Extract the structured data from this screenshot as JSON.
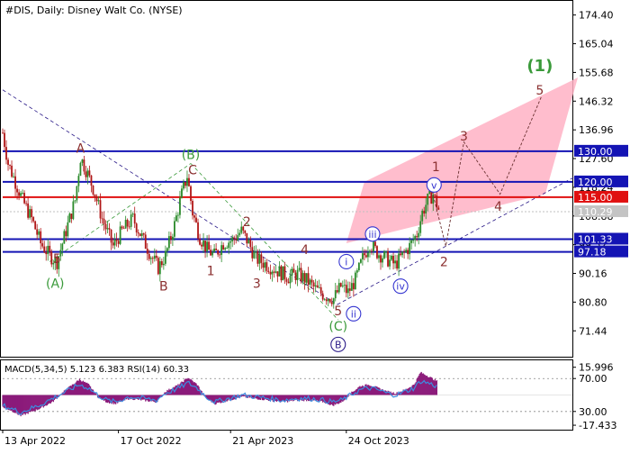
{
  "chart_data": [
    {
      "type": "candlestick",
      "title": "#DIS, Daily:  Disney Walt Co. (NYSE)",
      "ylim": [
        63.0,
        179.0
      ],
      "y_ticks": [
        71.44,
        80.8,
        90.16,
        99.52,
        108.88,
        118.24,
        127.6,
        136.96,
        146.32,
        155.68,
        165.04,
        174.4
      ],
      "y_tick_labels": [
        "71.44",
        "80.80",
        "90.16",
        "99.52",
        "108.88",
        "118.24",
        "127.60",
        "136.96",
        "146.32",
        "155.68",
        "165.04",
        "174.40"
      ],
      "x_ticks": [
        {
          "label": "13 Apr 2022",
          "index": 0
        },
        {
          "label": "17 Oct 2022",
          "index": 128
        },
        {
          "label": "21 Apr 2023",
          "index": 252
        },
        {
          "label": "24 Oct 2023",
          "index": 380
        }
      ],
      "x_range": [
        0,
        630
      ],
      "last_price": 110.29,
      "price_points": [
        [
          0,
          136
        ],
        [
          6,
          126
        ],
        [
          14,
          120
        ],
        [
          22,
          114
        ],
        [
          32,
          108
        ],
        [
          42,
          100
        ],
        [
          52,
          96
        ],
        [
          60,
          94
        ],
        [
          70,
          104
        ],
        [
          80,
          114
        ],
        [
          86,
          128
        ],
        [
          92,
          124
        ],
        [
          100,
          118
        ],
        [
          110,
          108
        ],
        [
          122,
          99
        ],
        [
          132,
          104
        ],
        [
          144,
          108
        ],
        [
          154,
          102
        ],
        [
          164,
          96
        ],
        [
          172,
          92
        ],
        [
          180,
          96
        ],
        [
          190,
          106
        ],
        [
          198,
          116
        ],
        [
          204,
          122
        ],
        [
          210,
          110
        ],
        [
          218,
          102
        ],
        [
          226,
          98
        ],
        [
          234,
          96
        ],
        [
          244,
          100
        ],
        [
          254,
          101
        ],
        [
          264,
          104
        ],
        [
          272,
          100
        ],
        [
          280,
          95
        ],
        [
          292,
          93
        ],
        [
          304,
          91
        ],
        [
          316,
          89
        ],
        [
          326,
          90
        ],
        [
          336,
          88
        ],
        [
          346,
          85
        ],
        [
          356,
          83
        ],
        [
          366,
          82
        ],
        [
          374,
          86
        ],
        [
          382,
          84
        ],
        [
          390,
          88
        ],
        [
          398,
          95
        ],
        [
          406,
          100
        ],
        [
          414,
          97
        ],
        [
          424,
          95
        ],
        [
          434,
          93
        ],
        [
          442,
          96
        ],
        [
          450,
          99
        ],
        [
          458,
          103
        ],
        [
          464,
          110
        ],
        [
          470,
          114
        ],
        [
          476,
          116
        ],
        [
          482,
          111
        ]
      ],
      "horizontal_levels": [
        {
          "value": 130.0,
          "label": "130.00",
          "color": "#1414b4",
          "label_bg": "#1414b4"
        },
        {
          "value": 120.0,
          "label": "120.00",
          "color": "#1414b4",
          "label_bg": "#1414b4"
        },
        {
          "value": 115.0,
          "label": "115.00",
          "color": "#e01010",
          "label_bg": "#e01010"
        },
        {
          "value": 101.33,
          "label": "101.33",
          "color": "#1414b4",
          "label_bg": "#1414b4"
        },
        {
          "value": 97.18,
          "label": "97.18",
          "color": "#1414b4",
          "label_bg": "#1414b4"
        }
      ],
      "last_price_label": "110.29",
      "wave_labels": [
        {
          "text": "A",
          "index": 86,
          "value": 131,
          "style": "brown"
        },
        {
          "text": "5",
          "index": 60,
          "value": 95,
          "style": "brown"
        },
        {
          "text": "(A)",
          "index": 58,
          "value": 87,
          "style": "green"
        },
        {
          "text": "B",
          "index": 178,
          "value": 86,
          "style": "brown"
        },
        {
          "text": "(B)",
          "index": 208,
          "value": 129,
          "style": "green"
        },
        {
          "text": "C",
          "index": 210,
          "value": 124,
          "style": "brown"
        },
        {
          "text": "1",
          "index": 230,
          "value": 91,
          "style": "brown"
        },
        {
          "text": "2",
          "index": 270,
          "value": 107,
          "style": "brown"
        },
        {
          "text": "3",
          "index": 281,
          "value": 87,
          "style": "brown"
        },
        {
          "text": "4",
          "index": 334,
          "value": 98,
          "style": "brown"
        },
        {
          "text": "5",
          "index": 371,
          "value": 78,
          "style": "brown"
        },
        {
          "text": "(C)",
          "index": 371,
          "value": 73,
          "style": "green"
        },
        {
          "text": "B",
          "index": 371,
          "value": 67,
          "style": "circle-navy"
        },
        {
          "text": "i",
          "index": 380,
          "value": 94,
          "style": "circle-blue"
        },
        {
          "text": "ii",
          "index": 388,
          "value": 77,
          "style": "circle-blue"
        },
        {
          "text": "iii",
          "index": 409,
          "value": 103,
          "style": "circle-blue"
        },
        {
          "text": "iv",
          "index": 440,
          "value": 86,
          "style": "circle-blue"
        },
        {
          "text": "v",
          "index": 477,
          "value": 119,
          "style": "circle-blue"
        },
        {
          "text": "1",
          "index": 479,
          "value": 125,
          "style": "brown"
        },
        {
          "text": "2",
          "index": 488,
          "value": 94,
          "style": "brown"
        },
        {
          "text": "3",
          "index": 510,
          "value": 135,
          "style": "brown"
        },
        {
          "text": "4",
          "index": 548,
          "value": 112,
          "style": "brown"
        },
        {
          "text": "5",
          "index": 594,
          "value": 150,
          "style": "brown"
        },
        {
          "text": "(1)",
          "index": 594,
          "value": 158,
          "style": "green-big"
        }
      ],
      "channel_polygon": [
        [
          400,
          120
        ],
        [
          636,
          154
        ],
        [
          600,
          116
        ],
        [
          380,
          100
        ]
      ],
      "forecast_path": [
        [
          475,
          117
        ],
        [
          490,
          99
        ],
        [
          510,
          133
        ],
        [
          550,
          116
        ],
        [
          596,
          148
        ]
      ],
      "trendlines": [
        {
          "points": [
            [
              0,
              150
            ],
            [
              370,
              80
            ]
          ],
          "style": "navy-dash"
        },
        {
          "points": [
            [
              370,
              80
            ],
            [
              635,
              122
            ]
          ],
          "style": "navy-dash"
        },
        {
          "points": [
            [
              52,
              94
            ],
            [
              208,
              126
            ]
          ],
          "style": "green-dash"
        },
        {
          "points": [
            [
              208,
              126
            ],
            [
              371,
              75
            ]
          ],
          "style": "green-dash"
        }
      ]
    },
    {
      "type": "histogram",
      "title": "MACD(5,34,5) 5.123 6.383 RSI(14) 60.33",
      "ylim": [
        -20,
        20
      ],
      "y_tick_labels": [
        "15.996",
        "70.00",
        "30.00",
        "-17.433"
      ],
      "y_tick_values": [
        15.996,
        9.5,
        -9.5,
        -17.433
      ],
      "macd_points": [
        [
          0,
          -7
        ],
        [
          10,
          -9
        ],
        [
          20,
          -12
        ],
        [
          30,
          -10
        ],
        [
          40,
          -8
        ],
        [
          55,
          -4
        ],
        [
          70,
          3
        ],
        [
          85,
          9
        ],
        [
          95,
          6
        ],
        [
          105,
          -1
        ],
        [
          115,
          -4
        ],
        [
          125,
          -5
        ],
        [
          140,
          -2
        ],
        [
          155,
          -3
        ],
        [
          170,
          -4
        ],
        [
          180,
          2
        ],
        [
          195,
          6
        ],
        [
          205,
          10
        ],
        [
          215,
          6
        ],
        [
          225,
          -2
        ],
        [
          235,
          -5
        ],
        [
          250,
          -3
        ],
        [
          265,
          -1
        ],
        [
          280,
          -2
        ],
        [
          295,
          -3
        ],
        [
          310,
          -4
        ],
        [
          325,
          -3
        ],
        [
          340,
          -3
        ],
        [
          355,
          -4
        ],
        [
          365,
          -6
        ],
        [
          375,
          -4
        ],
        [
          385,
          1
        ],
        [
          395,
          5
        ],
        [
          405,
          6
        ],
        [
          415,
          4
        ],
        [
          425,
          2
        ],
        [
          435,
          1
        ],
        [
          445,
          3
        ],
        [
          455,
          6
        ],
        [
          462,
          13
        ],
        [
          470,
          11
        ],
        [
          480,
          8
        ]
      ],
      "rsi_points": [
        [
          0,
          -6
        ],
        [
          10,
          -8
        ],
        [
          20,
          -10
        ],
        [
          30,
          -8
        ],
        [
          40,
          -6
        ],
        [
          55,
          -2
        ],
        [
          70,
          2
        ],
        [
          85,
          6
        ],
        [
          95,
          4
        ],
        [
          105,
          0
        ],
        [
          115,
          -3
        ],
        [
          125,
          -4
        ],
        [
          140,
          -1
        ],
        [
          155,
          -2
        ],
        [
          170,
          -3
        ],
        [
          180,
          1
        ],
        [
          195,
          4
        ],
        [
          205,
          7
        ],
        [
          215,
          4
        ],
        [
          225,
          -1
        ],
        [
          235,
          -4
        ],
        [
          250,
          -2
        ],
        [
          265,
          0
        ],
        [
          280,
          -1
        ],
        [
          295,
          -2
        ],
        [
          310,
          -3
        ],
        [
          325,
          -2
        ],
        [
          340,
          -2
        ],
        [
          355,
          -3
        ],
        [
          365,
          -4
        ],
        [
          375,
          -3
        ],
        [
          385,
          0
        ],
        [
          395,
          3
        ],
        [
          405,
          4
        ],
        [
          415,
          3
        ],
        [
          425,
          1
        ],
        [
          435,
          0
        ],
        [
          445,
          2
        ],
        [
          455,
          4
        ],
        [
          462,
          8
        ],
        [
          470,
          7
        ],
        [
          480,
          5
        ]
      ],
      "dotted_levels": [
        9.5,
        -9.5
      ]
    }
  ],
  "colors": {
    "up_candle": "#2a8a2a",
    "down_candle": "#b01616",
    "macd_hist": "#8b1a7a",
    "rsi_line": "#3c8ee0",
    "channel_fill": "#ffb2c4",
    "wave_brown": "#8b3030",
    "wave_green": "#3a9a3a",
    "wave_navy": "#2a1a88",
    "wave_blue": "#3434d0",
    "axis": "#000000",
    "grid_tick": "#555555"
  }
}
